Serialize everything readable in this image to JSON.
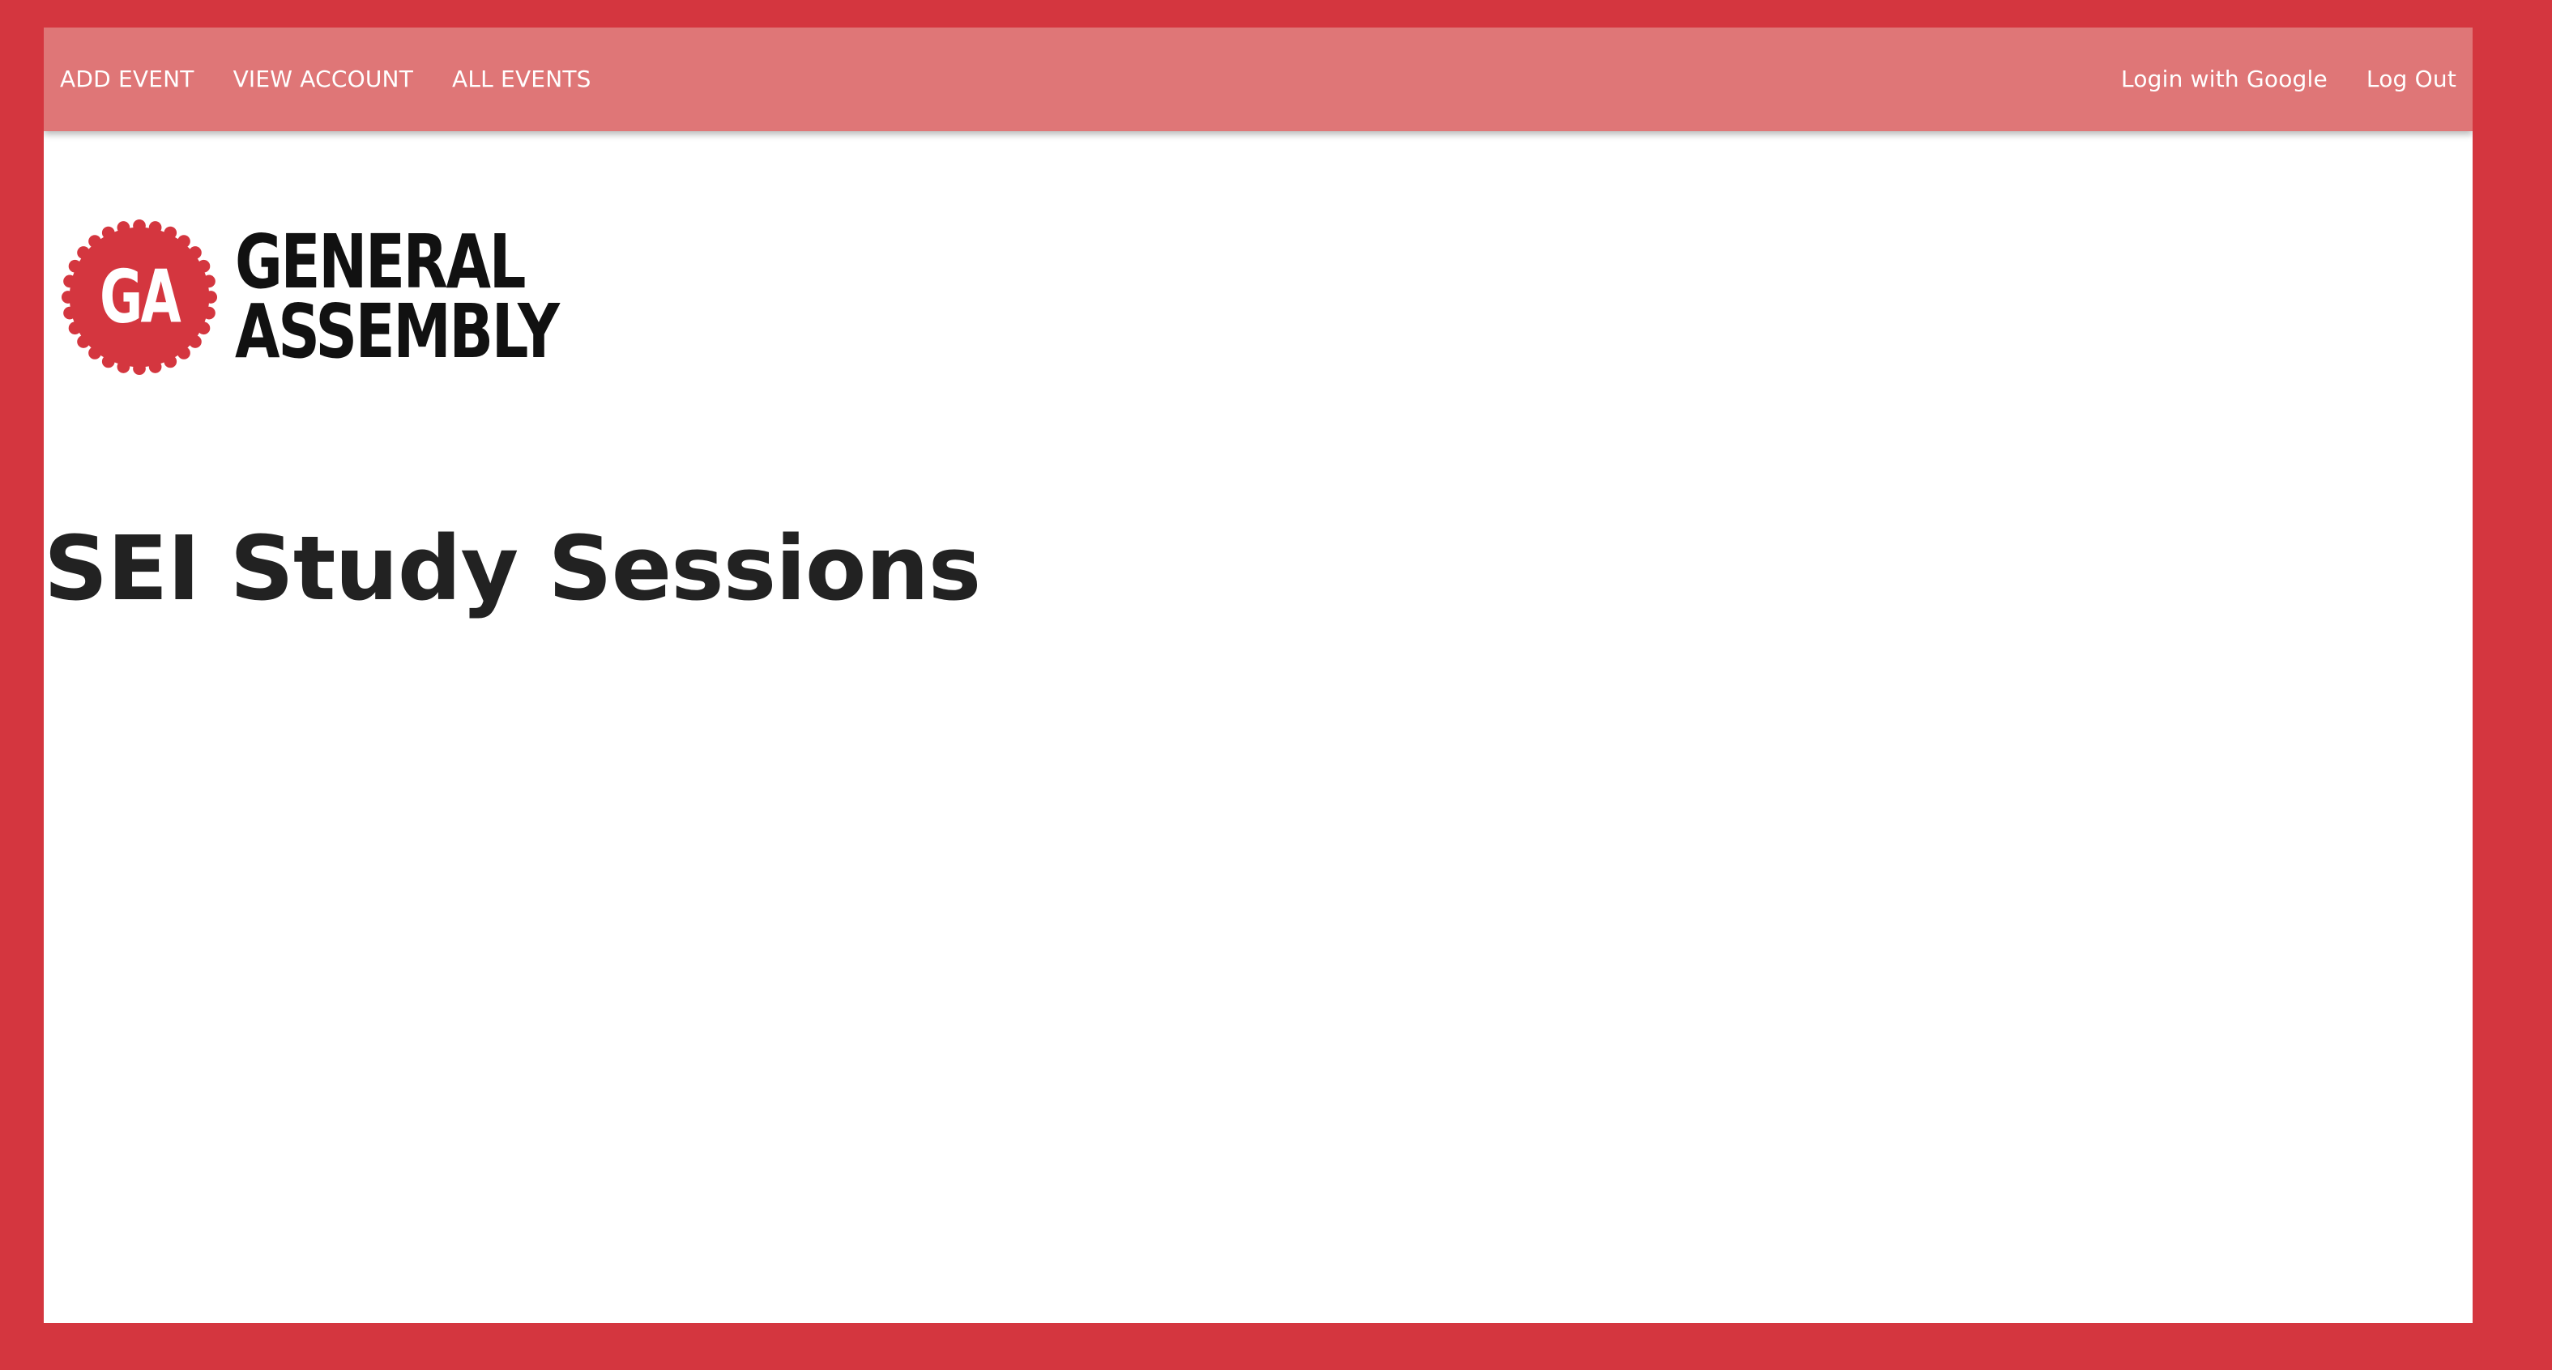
{
  "colors": {
    "page_background": "#d4363f",
    "navbar": "#df7677",
    "nav_text": "#ffffff",
    "brand_red": "#d4363f",
    "title_text": "#222222"
  },
  "nav": {
    "left": [
      {
        "label": "ADD EVENT"
      },
      {
        "label": "VIEW ACCOUNT"
      },
      {
        "label": "ALL EVENTS"
      }
    ],
    "right": [
      {
        "label": "Login with Google"
      },
      {
        "label": "Log Out"
      }
    ]
  },
  "logo": {
    "badge_text": "GA",
    "line1": "GENERAL",
    "line2": "ASSEMBLY",
    "icon": "general-assembly-logo"
  },
  "main": {
    "title": "SEI Study Sessions"
  }
}
